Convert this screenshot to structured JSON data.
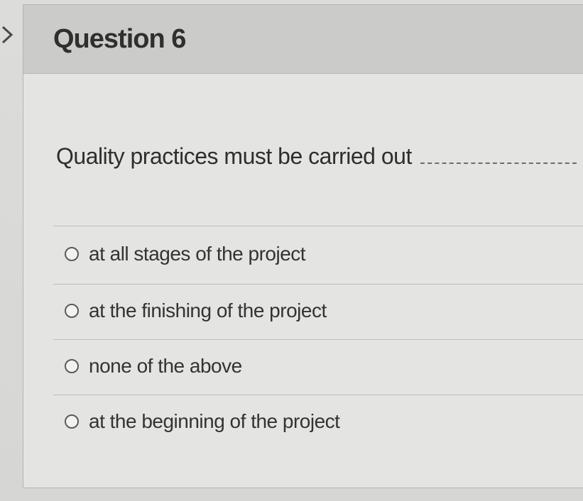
{
  "question": {
    "title": "Question 6",
    "text": "Quality practices must be carried out",
    "options": [
      {
        "label": "at all stages of the project",
        "selected": false
      },
      {
        "label": "at the finishing of the project",
        "selected": false
      },
      {
        "label": "none of the above",
        "selected": false
      },
      {
        "label": "at the beginning of the project",
        "selected": false
      }
    ]
  },
  "icons": {
    "nav": "chevron-right-icon",
    "option_control": "radio-button"
  }
}
